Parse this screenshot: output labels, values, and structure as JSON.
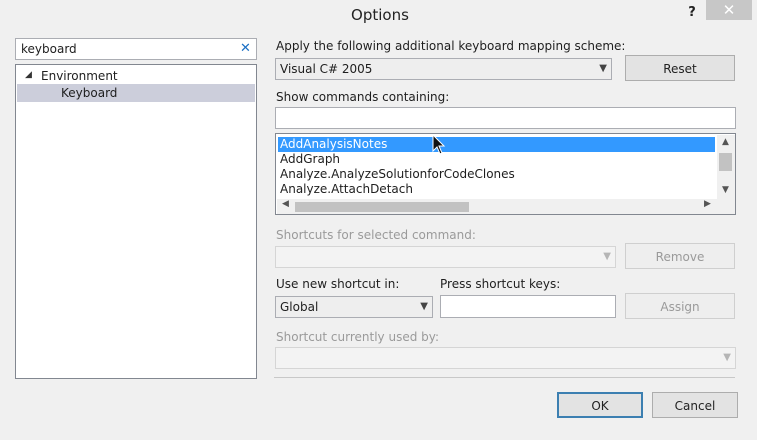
{
  "window": {
    "title": "Options",
    "help_glyph": "?",
    "close_glyph": "✕"
  },
  "search": {
    "value": "keyboard",
    "clear_glyph": "✕"
  },
  "tree": [
    {
      "label": "Environment",
      "toggle": "◢"
    },
    {
      "label": "Keyboard"
    }
  ],
  "mapping": {
    "label": "Apply the following additional keyboard mapping scheme:",
    "value": "Visual C# 2005",
    "reset_label": "Reset"
  },
  "commands": {
    "label": "Show commands containing:",
    "filter_value": "",
    "items": [
      "AddAnalysisNotes",
      "AddGraph",
      "Analyze.AnalyzeSolutionforCodeClones",
      "Analyze.AttachDetach"
    ],
    "selected_index": 0
  },
  "shortcuts": {
    "label": "Shortcuts for selected command:",
    "value": "",
    "remove_label": "Remove"
  },
  "use_in": {
    "label": "Use new shortcut in:",
    "value": "Global"
  },
  "press_keys": {
    "label": "Press shortcut keys:",
    "value": "",
    "assign_label": "Assign"
  },
  "used_by": {
    "label": "Shortcut currently used by:",
    "value": ""
  },
  "footer": {
    "ok_label": "OK",
    "cancel_label": "Cancel"
  },
  "colors": {
    "selection": "#3399ff",
    "accent_border": "#3c7fb1"
  }
}
